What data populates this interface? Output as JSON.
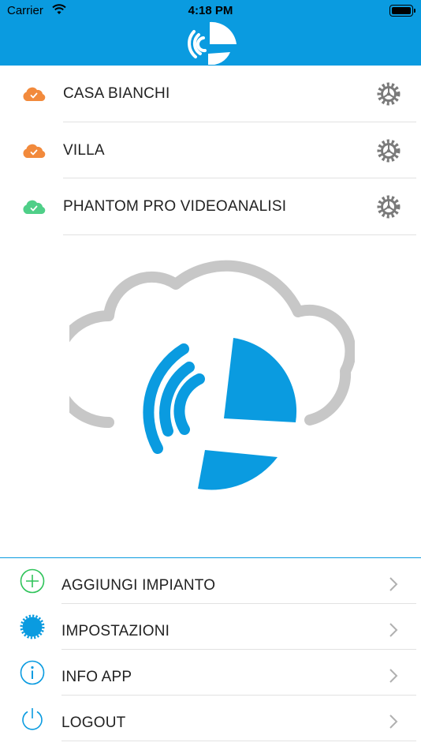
{
  "status_bar": {
    "carrier": "Carrier",
    "time": "4:18 PM"
  },
  "colors": {
    "brand_blue": "#0a9be0",
    "cloud_offline": "#f28a3c",
    "cloud_online": "#4fcf88",
    "gear_gray": "#7a7a7a"
  },
  "plants": [
    {
      "name": "CASA BIANCHI",
      "cloud_status": "orange"
    },
    {
      "name": "VILLA",
      "cloud_status": "orange"
    },
    {
      "name": "PHANTOM PRO VIDEOANALISI",
      "cloud_status": "green"
    }
  ],
  "menu": {
    "add_plant": "AGGIUNGI IMPIANTO",
    "settings": "IMPOSTAZIONI",
    "info": "INFO APP",
    "logout": "LOGOUT"
  }
}
